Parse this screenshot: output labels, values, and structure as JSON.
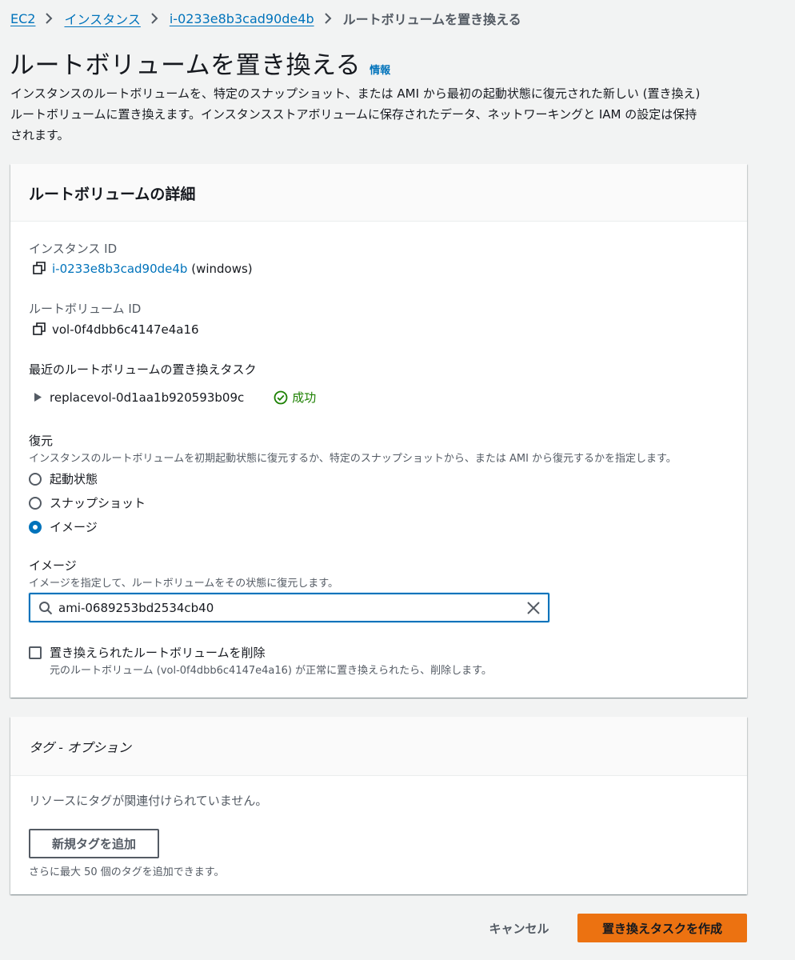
{
  "breadcrumb": {
    "items": [
      "EC2",
      "インスタンス",
      "i-0233e8b3cad90de4b"
    ],
    "current": "ルートボリュームを置き換える"
  },
  "header": {
    "title": "ルートボリュームを置き換える",
    "info_link": "情報",
    "description_line1": "インスタンスのルートボリュームを、特定のスナップショット、または AMI から最初の起動状態に復元された新しい (置き換え)",
    "description_line2": "ルートボリュームに置き換えます。インスタンスストアボリュームに保存されたデータ、ネットワーキングと IAM の設定は保持",
    "description_line3": "されます。"
  },
  "details_panel": {
    "title": "ルートボリュームの詳細",
    "instance_id_label": "インスタンス ID",
    "instance_id_value": "i-0233e8b3cad90de4b",
    "instance_name": "(windows)",
    "root_volume_label": "ルートボリューム ID",
    "root_volume_value": "vol-0f4dbb6c4147e4a16",
    "recent_tasks_label": "最近のルートボリュームの置き換えタスク",
    "recent_task_id": "replacevol-0d1aa1b920593b09c",
    "recent_task_status": "成功",
    "restore": {
      "label": "復元",
      "description": "インスタンスのルートボリュームを初期起動状態に復元するか、特定のスナップショットから、または AMI から復元するかを指定します。",
      "options": [
        "起動状態",
        "スナップショット",
        "イメージ"
      ],
      "selected_index": 2
    },
    "image": {
      "label": "イメージ",
      "description": "イメージを指定して、ルートボリュームをその状態に復元します。",
      "value": "ami-0689253bd2534cb40"
    },
    "delete_checkbox": {
      "label": "置き換えられたルートボリュームを削除",
      "description": "元のルートボリューム (vol-0f4dbb6c4147e4a16) が正常に置き換えられたら、削除します。",
      "checked": false
    }
  },
  "tags_panel": {
    "title": "タグ - オプション",
    "empty_text": "リソースにタグが関連付けられていません。",
    "add_button": "新規タグを追加",
    "limit_text": "さらに最大 50 個のタグを追加できます。"
  },
  "footer": {
    "cancel_label": "キャンセル",
    "submit_label": "置き換えタスクを作成"
  },
  "colors": {
    "link": "#0073bb",
    "primary_button": "#ec7211",
    "success": "#1d8102",
    "background": "#f2f3f3"
  }
}
